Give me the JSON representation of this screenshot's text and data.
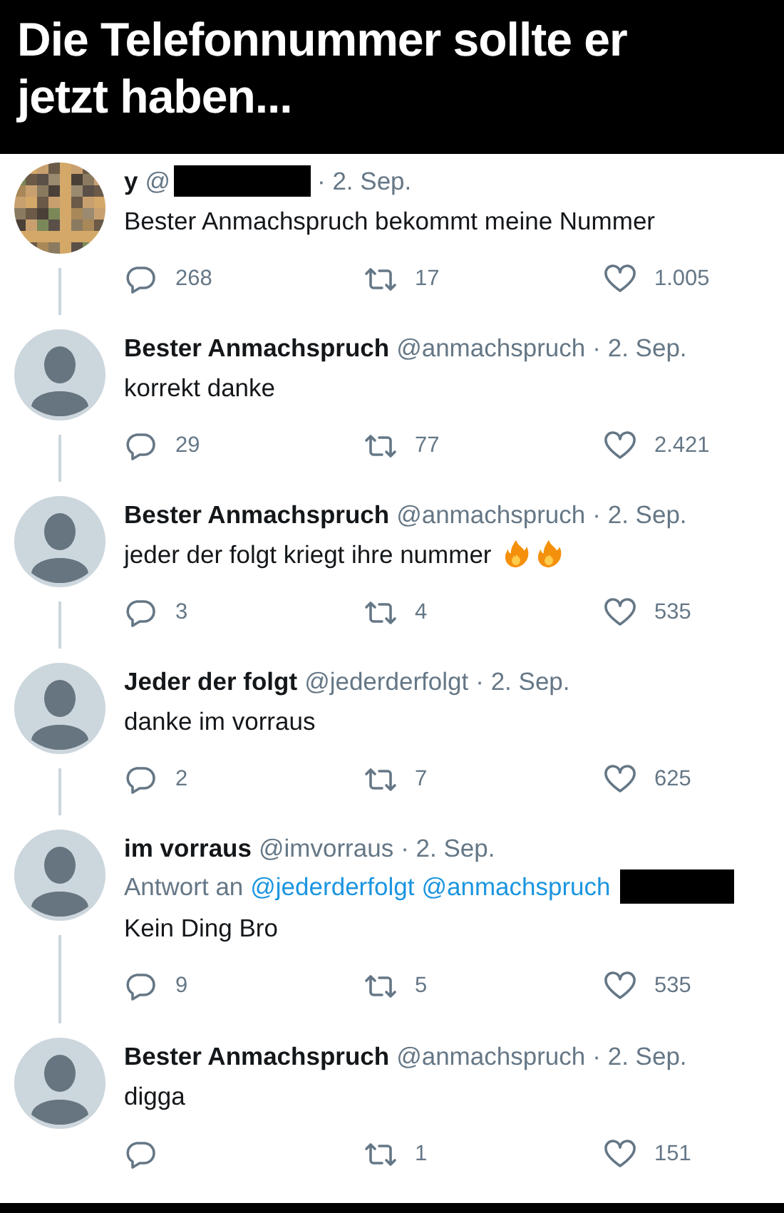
{
  "headline": "Die Telefonnummer sollte er jetzt haben...",
  "tweets": [
    {
      "name": "y",
      "handle": "@",
      "handle_redacted": true,
      "date": "· 2. Sep.",
      "text": "Bester Anmachspruch bekommt meine Nummer",
      "replies": "268",
      "retweets": "17",
      "likes": "1.005"
    },
    {
      "avatar": {
        "kind": "default"
      },
      "name": "Bester Anmachspruch",
      "handle": "@anmachspruch",
      "date": "· 2. Sep.",
      "text": "korrekt danke",
      "replies": "29",
      "retweets": "77",
      "likes": "2.421"
    },
    {
      "avatar": {
        "kind": "default"
      },
      "name": "Bester Anmachspruch",
      "handle": "@anmachspruch",
      "date": "· 2. Sep.",
      "text": "jeder der folgt kriegt ihre nummer",
      "emoji": [
        {
          "kind": "fire"
        },
        {
          "kind": "fire"
        }
      ],
      "replies": "3",
      "retweets": "4",
      "likes": "535"
    },
    {
      "avatar": {
        "kind": "default"
      },
      "name": "Jeder der folgt",
      "handle": "@jederderfolgt",
      "date": "· 2. Sep.",
      "text": "danke im vorraus",
      "replies": "2",
      "retweets": "7",
      "likes": "625"
    },
    {
      "avatar": {
        "kind": "default"
      },
      "name": "im vorraus",
      "handle": "@imvorraus",
      "date": "· 2. Sep.",
      "reply_to": {
        "label": "Antwort an",
        "mentions": [
          "@jederderfolgt",
          "@anmachspruch"
        ],
        "redacted": true
      },
      "text": "Kein Ding Bro",
      "replies": "9",
      "retweets": "5",
      "likes": "535"
    },
    {
      "avatar": {
        "kind": "default"
      },
      "name": "Bester Anmachspruch",
      "handle": "@anmachspruch",
      "date": "· 2. Sep.",
      "text": "digga",
      "retweets": "1",
      "likes": "151"
    }
  ]
}
